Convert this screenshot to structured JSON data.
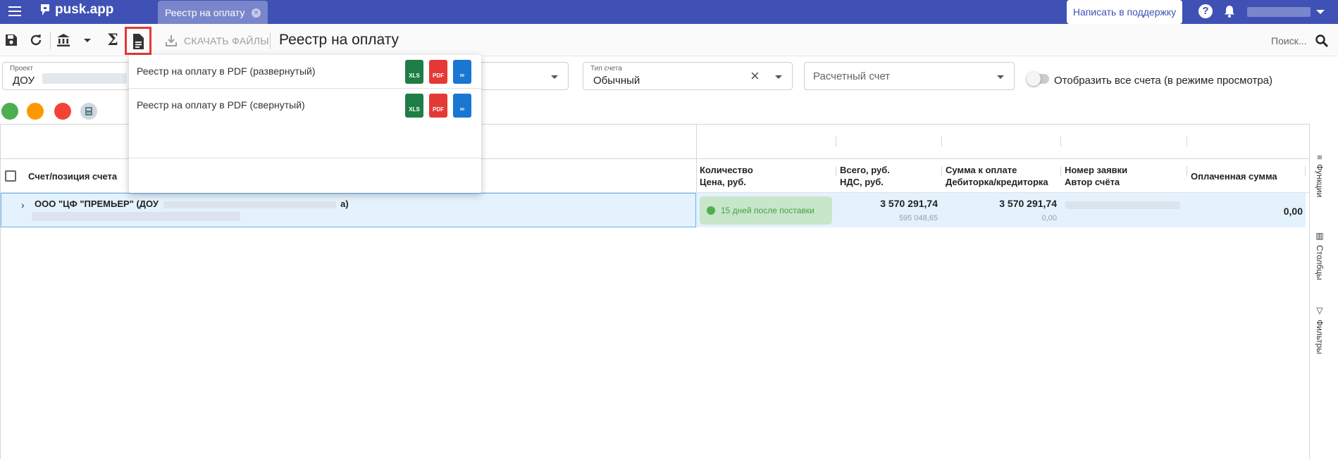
{
  "app": {
    "logo": "pusk.app"
  },
  "tabs": [
    {
      "label": "Реестр на оплату"
    }
  ],
  "header": {
    "support_label": "Написать в поддержку",
    "help_glyph": "?"
  },
  "toolbar": {
    "sigma": "Σ",
    "download_label": "СКАЧАТЬ ФАЙЛЫ",
    "page_title": "Реестр на оплату",
    "search_placeholder": "Поиск..."
  },
  "filters": {
    "project": {
      "label": "Проект",
      "value": "ДОУ"
    },
    "invoice_type": {
      "label": "Тип счета",
      "value": "Обычный"
    },
    "account": {
      "placeholder": "Расчетный счет"
    },
    "show_all_label": "Отобразить все счета (в режиме просмотра)"
  },
  "status_colors": [
    "#4caf50",
    "#ff9800",
    "#f44336"
  ],
  "dropdown": {
    "items": [
      {
        "label": "Реестр на оплату в PDF (развернутый)",
        "formats": [
          "XLS",
          "PDF",
          "✉"
        ]
      },
      {
        "label": "Реестр на оплату в PDF (свернутый)",
        "formats": [
          "XLS",
          "PDF",
          "✉"
        ]
      }
    ]
  },
  "grid": {
    "columns": [
      {
        "line1": "Счет/позиция счета",
        "line2": ""
      },
      {
        "line1": "Количество",
        "line2": "Цена, руб."
      },
      {
        "line1": "Всего, руб.",
        "line2": "НДС, руб."
      },
      {
        "line1": "Сумма к оплате",
        "line2": "Дебиторка/кредиторка"
      },
      {
        "line1": "Номер заявки",
        "line2": "Автор счёта"
      },
      {
        "line1": "Оплаченная сумма",
        "line2": ""
      }
    ],
    "rows": [
      {
        "expand_glyph": "›",
        "name_start": "ООО \"ЦФ \"ПРЕМЬЕР\" (ДОУ",
        "name_end": "а)",
        "status": "15 дней после поставки",
        "total": "3 570 291,74",
        "vat": "595 048,65",
        "to_pay": "3 570 291,74",
        "debt": "0,00",
        "paid": "0,00"
      }
    ]
  },
  "right_sidebar": [
    {
      "label": "Функции",
      "icon": "functions-icon"
    },
    {
      "label": "Столбцы",
      "icon": "columns-icon"
    },
    {
      "label": "Фильтры",
      "icon": "filter-icon"
    }
  ]
}
